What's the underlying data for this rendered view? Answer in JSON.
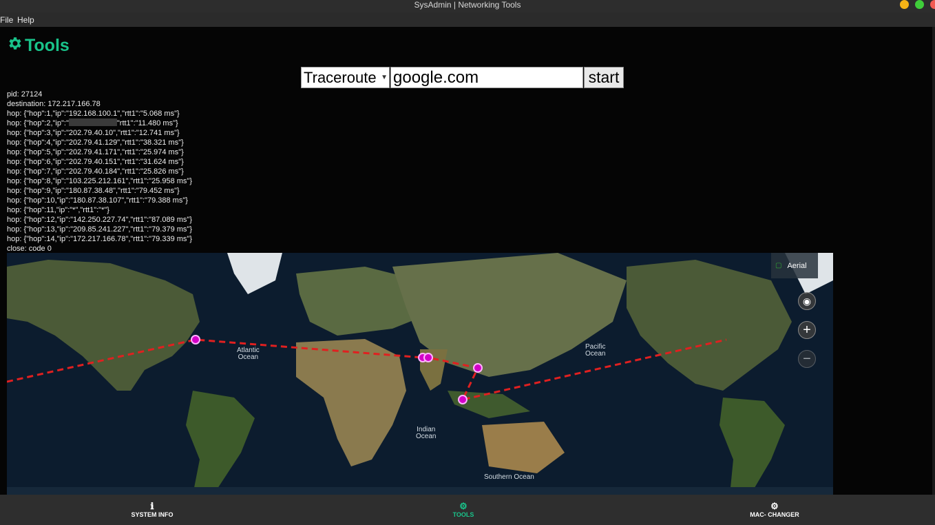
{
  "window": {
    "title": "SysAdmin | Networking Tools"
  },
  "menu": {
    "file": "File",
    "help": "Help"
  },
  "page": {
    "title": "Tools",
    "icon": "gear-icon",
    "accent_color": "#19c38a"
  },
  "controls": {
    "tool_selected": "Traceroute",
    "host_value": "google.com",
    "start_label": "start"
  },
  "log": {
    "pid": "pid: 27124",
    "destination": "destination: 172.217.166.78",
    "hops": [
      "hop: {\"hop\":1,\"ip\":\"192.168.100.1\",\"rtt1\":\"5.068 ms\"}",
      "hop: {\"hop\":2,\"ip\":\"",
      "hop: {\"hop\":3,\"ip\":\"202.79.40.10\",\"rtt1\":\"12.741 ms\"}",
      "hop: {\"hop\":4,\"ip\":\"202.79.41.129\",\"rtt1\":\"38.321 ms\"}",
      "hop: {\"hop\":5,\"ip\":\"202.79.41.171\",\"rtt1\":\"25.974 ms\"}",
      "hop: {\"hop\":6,\"ip\":\"202.79.40.151\",\"rtt1\":\"31.624 ms\"}",
      "hop: {\"hop\":7,\"ip\":\"202.79.40.184\",\"rtt1\":\"25.826 ms\"}",
      "hop: {\"hop\":8,\"ip\":\"103.225.212.161\",\"rtt1\":\"25.958 ms\"}",
      "hop: {\"hop\":9,\"ip\":\"180.87.38.48\",\"rtt1\":\"79.452 ms\"}",
      "hop: {\"hop\":10,\"ip\":\"180.87.38.107\",\"rtt1\":\"79.388 ms\"}",
      "hop: {\"hop\":11,\"ip\":\"*\",\"rtt1\":\"*\"}",
      "hop: {\"hop\":12,\"ip\":\"142.250.227.74\",\"rtt1\":\"87.089 ms\"}",
      "hop: {\"hop\":13,\"ip\":\"209.85.241.227\",\"rtt1\":\"79.379 ms\"}",
      "hop: {\"hop\":14,\"ip\":\"172.217.166.78\",\"rtt1\":\"79.339 ms\"}"
    ],
    "hop2_tail": "\"rtt1\":\"11.480 ms\"}",
    "close": "close: code 0"
  },
  "map": {
    "layer_label": "Aerial",
    "oceans": {
      "atlantic": "Atlantic\nOcean",
      "pacific": "Pacific\nOcean",
      "indian": "Indian\nOcean",
      "southern": "Southern Ocean"
    },
    "route_color": "#e02020",
    "marker_color": "#d400c8"
  },
  "nav": {
    "system_info": "SYSTEM INFO",
    "tools": "TOOLS",
    "mac_changer": "MAC- CHANGER"
  }
}
